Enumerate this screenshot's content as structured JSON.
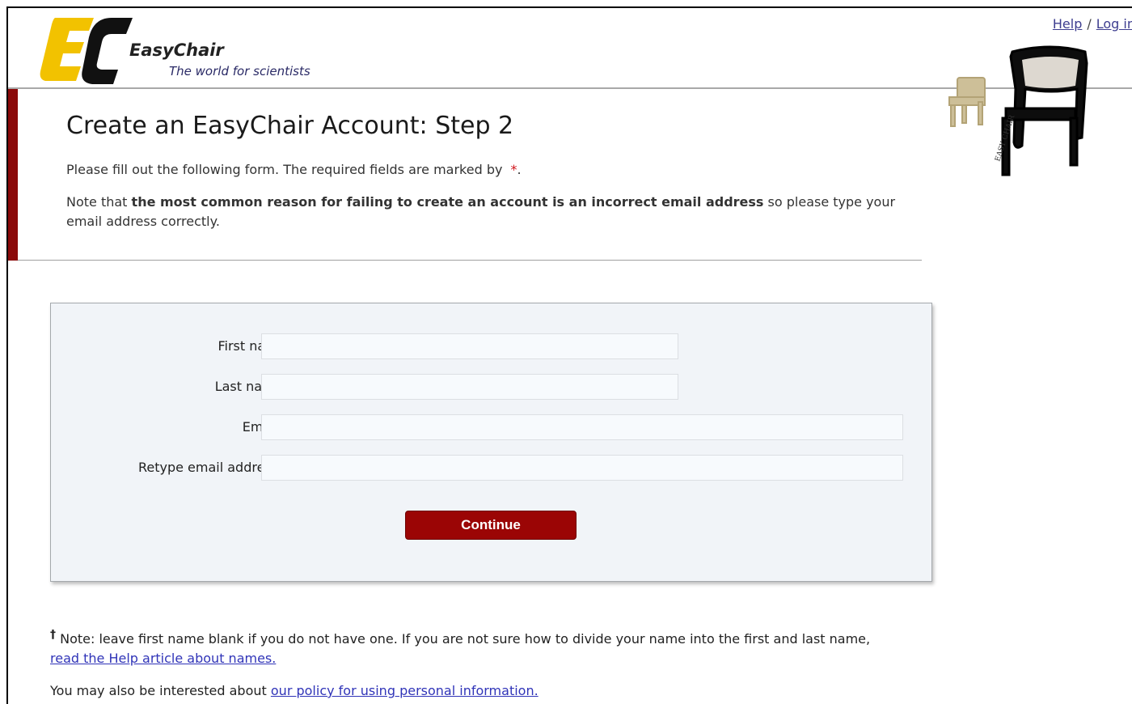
{
  "header": {
    "logo_name": "EasyChair",
    "logo_tagline": "The world for scientists",
    "help_link": "Help",
    "separator": "/",
    "login_link": "Log in",
    "brand_colors": {
      "yellow": "#f2c200",
      "black": "#111111",
      "accent_red": "#8b0a0a"
    }
  },
  "intro": {
    "title": "Create an EasyChair Account: Step 2",
    "required_text": "Please fill out the following form. The required fields are marked by",
    "required_marker": "*",
    "required_end": ".",
    "note_prefix": "Note that",
    "note_bold": "the most common reason for failing to create an account is an incorrect email address",
    "note_suffix": "so please type your email address correctly."
  },
  "form": {
    "first_name": {
      "label": "First name",
      "marker": "†",
      "colon": ":",
      "value": "",
      "placeholder": ""
    },
    "last_name": {
      "label": "Last name",
      "marker": "*",
      "value": "",
      "placeholder": ""
    },
    "email": {
      "label": "Email:",
      "marker": "*",
      "value": "",
      "placeholder": ""
    },
    "retype_email": {
      "label": "Retype email address:",
      "marker": "*",
      "value": "",
      "placeholder": ""
    },
    "continue_label": "Continue",
    "button_color": "#9b0505"
  },
  "notes": {
    "dagger": "†",
    "names_note": "Note: leave first name blank if you do not have one. If you are not sure how to divide your name into the first and last name,",
    "names_link": "read the Help article about names.",
    "policy_prefix": "You may also be interested about",
    "policy_link": "our policy for using personal information."
  }
}
